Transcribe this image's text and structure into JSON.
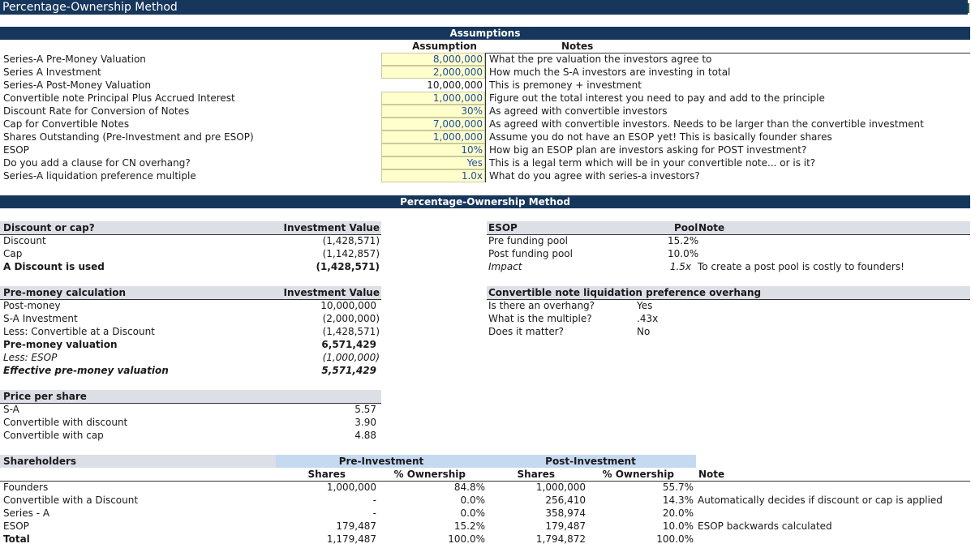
{
  "title": "Percentage-Ownership Method",
  "assumptions": {
    "header": "Assumptions",
    "col_assumption": "Assumption",
    "col_notes": "Notes",
    "rows": [
      {
        "label": "Series-A Pre-Money Valuation",
        "value": "8,000,000",
        "note": "What the pre valuation the investors agree to",
        "input": true
      },
      {
        "label": "Series A Investment",
        "value": "2,000,000",
        "note": "How much the S-A investors are investing in total",
        "input": true
      },
      {
        "label": "Series-A Post-Money Valuation",
        "value": "10,000,000",
        "note": "This is premoney + investment",
        "input": false
      },
      {
        "label": "Convertible note Principal Plus Accrued Interest",
        "value": "1,000,000",
        "note": "Figure out the total interest you need to pay and add to the principle",
        "input": true
      },
      {
        "label": "Discount Rate for Conversion of Notes",
        "value": "30%",
        "note": "As agreed with convertible investors",
        "input": true
      },
      {
        "label": "Cap for Convertible Notes",
        "value": "7,000,000",
        "note": "As agreed with convertible investors. Needs to be larger than the convertible investment",
        "input": true
      },
      {
        "label": "Shares Outstanding (Pre-Investment and pre ESOP)",
        "value": "1,000,000",
        "note": "Assume you do not have an ESOP yet! This is basically founder shares",
        "input": true
      },
      {
        "label": "ESOP",
        "value": "10%",
        "note": "How big an ESOP plan are investors asking for POST investment?",
        "input": true
      },
      {
        "label": "Do you add a clause for CN overhang?",
        "value": "Yes",
        "note": "This is a legal term which will be in your convertible note... or is it?",
        "input": true
      },
      {
        "label": "Series-A liquidation preference multiple",
        "value": "1.0x",
        "note": "What do you agree with series-a investors?",
        "input": true
      }
    ]
  },
  "method_header": "Percentage-Ownership Method",
  "discount_cap": {
    "header": "Discount or cap?",
    "col": "Investment Value",
    "rows": [
      {
        "label": "Discount",
        "value": "(1,428,571)"
      },
      {
        "label": "Cap",
        "value": "(1,142,857)"
      },
      {
        "label": "A Discount is used",
        "value": "(1,428,571)"
      }
    ]
  },
  "esop": {
    "header": "ESOP",
    "col_pool": "Pool",
    "col_note": "Note",
    "rows": [
      {
        "label": "Pre funding pool",
        "value": "15.2%",
        "note": ""
      },
      {
        "label": "Post funding pool",
        "value": "10.0%",
        "note": ""
      },
      {
        "label": "Impact",
        "value": "1.5x",
        "note": "To create a post pool is costly to founders!"
      }
    ]
  },
  "premoney": {
    "header": "Pre-money calculation",
    "col": "Investment Value",
    "rows": [
      {
        "label": "Post-money",
        "value": "10,000,000"
      },
      {
        "label": "S-A Investment",
        "value": "(2,000,000)"
      },
      {
        "label": "Less: Convertible at a Discount",
        "value": "(1,428,571)"
      },
      {
        "label": "Pre-money valuation",
        "value": "6,571,429"
      },
      {
        "label": "Less: ESOP",
        "value": "(1,000,000)"
      },
      {
        "label": "Effective pre-money valuation",
        "value": "5,571,429"
      }
    ]
  },
  "overhang": {
    "header": "Convertible note liquidation preference overhang",
    "rows": [
      {
        "label": "Is there an overhang?",
        "value": "Yes"
      },
      {
        "label": "What is the multiple?",
        "value": ".43x"
      },
      {
        "label": "Does it matter?",
        "value": "No"
      }
    ]
  },
  "price": {
    "header": "Price per share",
    "rows": [
      {
        "label": "S-A",
        "value": "5.57"
      },
      {
        "label": "Convertible with discount",
        "value": "3.90"
      },
      {
        "label": "Convertible with cap",
        "value": "4.88"
      }
    ]
  },
  "shareholders": {
    "header": "Shareholders",
    "pre_header": "Pre-Investment",
    "post_header": "Post-Investment",
    "col_shares": "Shares",
    "col_own": "% Ownership",
    "col_note": "Note",
    "rows": [
      {
        "label": "Founders",
        "pre_shares": "1,000,000",
        "pre_own": "84.8%",
        "post_shares": "1,000,000",
        "post_own": "55.7%",
        "note": ""
      },
      {
        "label": "Convertible with a Discount",
        "pre_shares": "-",
        "pre_own": "0.0%",
        "post_shares": "256,410",
        "post_own": "14.3%",
        "note": "Automatically decides if discount or cap is applied"
      },
      {
        "label": "Series - A",
        "pre_shares": "-",
        "pre_own": "0.0%",
        "post_shares": "358,974",
        "post_own": "20.0%",
        "note": ""
      },
      {
        "label": "ESOP",
        "pre_shares": "179,487",
        "pre_own": "15.2%",
        "post_shares": "179,487",
        "post_own": "10.0%",
        "note": "ESOP backwards calculated"
      },
      {
        "label": "Total",
        "pre_shares": "1,179,487",
        "pre_own": "100.0%",
        "post_shares": "1,794,872",
        "post_own": "100.0%",
        "note": ""
      }
    ]
  }
}
